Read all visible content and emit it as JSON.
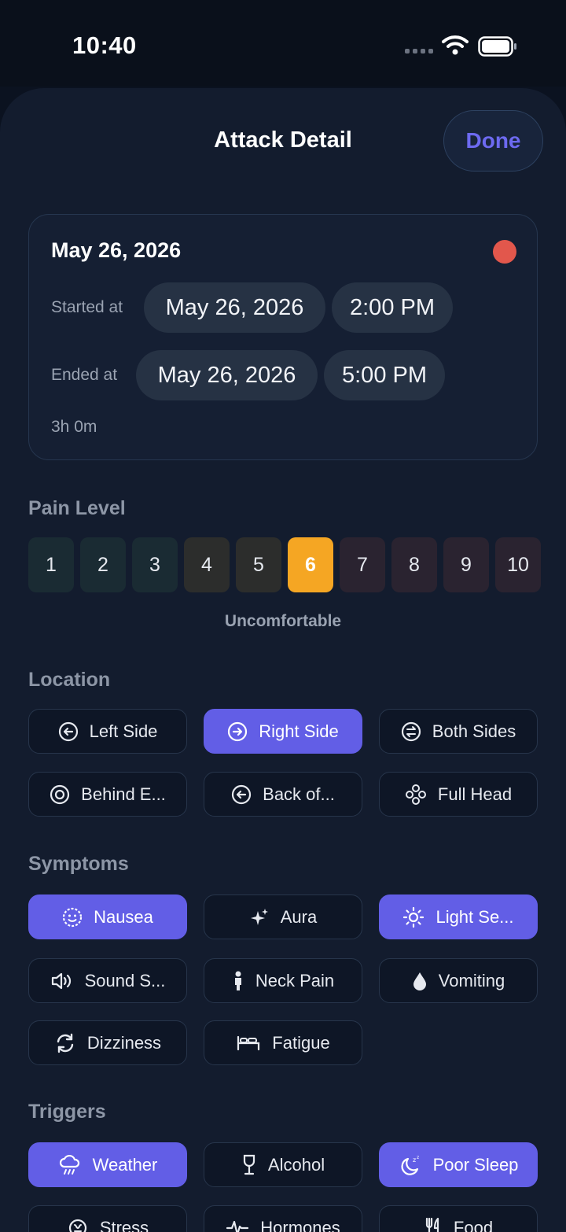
{
  "status_bar": {
    "time": "10:40"
  },
  "header": {
    "title": "Attack Detail",
    "done_label": "Done"
  },
  "attack_card": {
    "date": "May 26, 2026",
    "started_label": "Started at",
    "started_date": "May 26, 2026",
    "started_time": "2:00 PM",
    "ended_label": "Ended at",
    "ended_date": "May 26, 2026",
    "ended_time": "5:00 PM",
    "duration": "3h 0m",
    "status_color": "#e2574c"
  },
  "pain_level": {
    "title": "Pain Level",
    "levels": [
      "1",
      "2",
      "3",
      "4",
      "5",
      "6",
      "7",
      "8",
      "9",
      "10"
    ],
    "selected": 6,
    "selected_color": "#f5a623",
    "description": "Uncomfortable"
  },
  "location": {
    "title": "Location",
    "items": [
      {
        "label": "Left Side",
        "icon": "arrow-left-circle-icon",
        "selected": false
      },
      {
        "label": "Right Side",
        "icon": "arrow-right-circle-icon",
        "selected": true
      },
      {
        "label": "Both Sides",
        "icon": "arrows-swap-circle-icon",
        "selected": false
      },
      {
        "label": "Behind E...",
        "icon": "eye-circle-icon",
        "selected": false
      },
      {
        "label": "Back of...",
        "icon": "arrow-left-circle-icon",
        "selected": false
      },
      {
        "label": "Full Head",
        "icon": "circles-cluster-icon",
        "selected": false
      }
    ]
  },
  "symptoms": {
    "title": "Symptoms",
    "items": [
      {
        "label": "Nausea",
        "icon": "face-icon",
        "selected": true
      },
      {
        "label": "Aura",
        "icon": "sparkles-icon",
        "selected": false
      },
      {
        "label": "Light Se...",
        "icon": "sun-icon",
        "selected": true
      },
      {
        "label": "Sound S...",
        "icon": "speaker-icon",
        "selected": false
      },
      {
        "label": "Neck Pain",
        "icon": "person-icon",
        "selected": false
      },
      {
        "label": "Vomiting",
        "icon": "drop-icon",
        "selected": false
      },
      {
        "label": "Dizziness",
        "icon": "rotate-icon",
        "selected": false
      },
      {
        "label": "Fatigue",
        "icon": "bed-icon",
        "selected": false
      }
    ]
  },
  "triggers": {
    "title": "Triggers",
    "items": [
      {
        "label": "Weather",
        "icon": "cloud-rain-icon",
        "selected": true
      },
      {
        "label": "Alcohol",
        "icon": "wine-glass-icon",
        "selected": false
      },
      {
        "label": "Poor Sleep",
        "icon": "moon-zzz-icon",
        "selected": true
      },
      {
        "label": "Stress",
        "icon": "brain-icon",
        "selected": false
      },
      {
        "label": "Hormones",
        "icon": "waveform-icon",
        "selected": false
      },
      {
        "label": "Food",
        "icon": "fork-knife-icon",
        "selected": false
      }
    ]
  },
  "colors": {
    "accent": "#625ee6",
    "background": "#131c2e"
  }
}
